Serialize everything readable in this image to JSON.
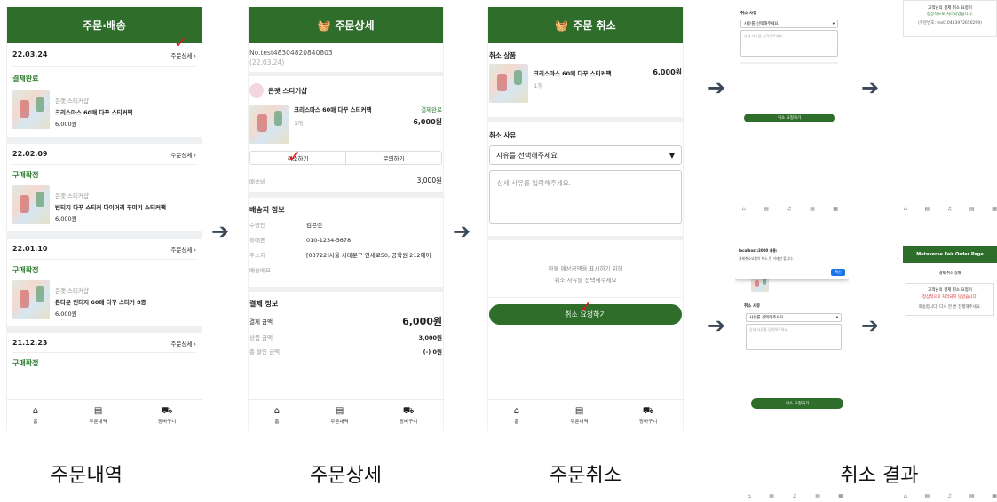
{
  "screen1": {
    "title": "주문·배송",
    "orders": [
      {
        "date": "22.03.24",
        "detail": "주문상세",
        "status": "결제완료",
        "shop": "콘랫 스티커샵",
        "name": "크리스마스 60매 다꾸 스티커팩",
        "price": "6,000원"
      },
      {
        "date": "22.02.09",
        "detail": "주문상세",
        "status": "구매확정",
        "shop": "콘랫 스티커샵",
        "name": "빈티지 다꾸 스티커 다이어리 꾸미기 스티커팩",
        "price": "6,000원"
      },
      {
        "date": "22.01.10",
        "detail": "주문상세",
        "status": "구매확정",
        "shop": "콘랫 스티커샵",
        "name": "톤다운 빈티지 60매 다꾸 스티커 8종",
        "price": "6,000원"
      },
      {
        "date": "21.12.23",
        "detail": "주문상세",
        "status": "구매확정"
      }
    ]
  },
  "tabs": {
    "home": "홈",
    "orders": "주문내역",
    "cart": "장바구니"
  },
  "screen2": {
    "title": "주문상세",
    "order_no": "No.test48304820840803",
    "order_date": "(22.03.24)",
    "shop": "콘랫 스티커샵",
    "item_name": "크리스마스 60매 다꾸 스티커팩",
    "item_status": "결제완료",
    "item_qty": "1개",
    "item_price": "6,000원",
    "cancel_btn": "취소하기",
    "inquiry_btn": "문의하기",
    "shipping_label": "배송비",
    "shipping_fee": "3,000원",
    "address_section": "배송지 정보",
    "recipient_label": "수령인",
    "recipient": "김콘랫",
    "phone_label": "휴대폰",
    "phone": "010-1234-5678",
    "address_label": "주소지",
    "address": "[03722]서울 서대문구 연세로50, 공학원 212예이",
    "memo_label": "배송메모",
    "pay_section": "결제 정보",
    "pay_amount_label": "결제 금액",
    "pay_amount": "6,000원",
    "goods_amount_label": "상품 금액",
    "goods_amount": "3,000원",
    "discount_label": "총 할인 금액",
    "discount": "(-) 0원"
  },
  "screen3": {
    "title": "주문 취소",
    "cancel_items_label": "취소 상품",
    "item_name": "크리스마스 60매 다꾸 스티커팩",
    "item_qty": "1개",
    "item_price": "6,000원",
    "reason_label": "취소 사유",
    "reason_select": "사유를 선택해주세요",
    "reason_placeholder": "상세 사유를 입력해주세요.",
    "notice_line1": "환불 예상금액을 표시하기 위해",
    "notice_line2": "취소 사유를 선택해주세요",
    "submit_btn": "취소 요청하기"
  },
  "screen4": {
    "top_left_label": "취소 사유",
    "top_left_select": "사유를 선택해주세요",
    "top_left_placeholder": "상세 사유를 입력해주세요.",
    "top_left_btn": "취소 요청하기",
    "top_right_line1": "고객님의 결제 취소 요청이",
    "top_right_line2": "정상적으로 처리되었습니다.",
    "top_right_line3": "(주문번호: test10483972650299)",
    "bottom_left_dialog_line1": "localhost:3000 내용:",
    "bottom_left_dialog_line2": "결제취소요청이 취소 된 거래만 합니다.",
    "bottom_left_dialog_btn": "확인",
    "bottom_left_label": "취소 사유",
    "bottom_left_select": "사유를 선택해주세요",
    "bottom_left_placeholder": "상세 사유를 입력해주세요.",
    "bottom_left_btn": "취소 요청하기",
    "bottom_right_header": "Metaverse Fair Order Page",
    "bottom_right_sub": "결제 취소 실패",
    "bottom_right_line1": "고객님의 결제 취소 요청이",
    "bottom_right_line2": "정상적으로 처리되지 않았습니다.",
    "bottom_right_line3": "죄송합니다. 다시 한 번 진행해주세요."
  },
  "captions": {
    "c1": "주문내역",
    "c2": "주문상세",
    "c3": "주문취소",
    "c4": "취소 결과"
  },
  "colors": {
    "brand_green": "#2f6d2a",
    "arrow": "#3a4756",
    "check_red": "#e0151b",
    "fail_red": "#d32f2f"
  }
}
